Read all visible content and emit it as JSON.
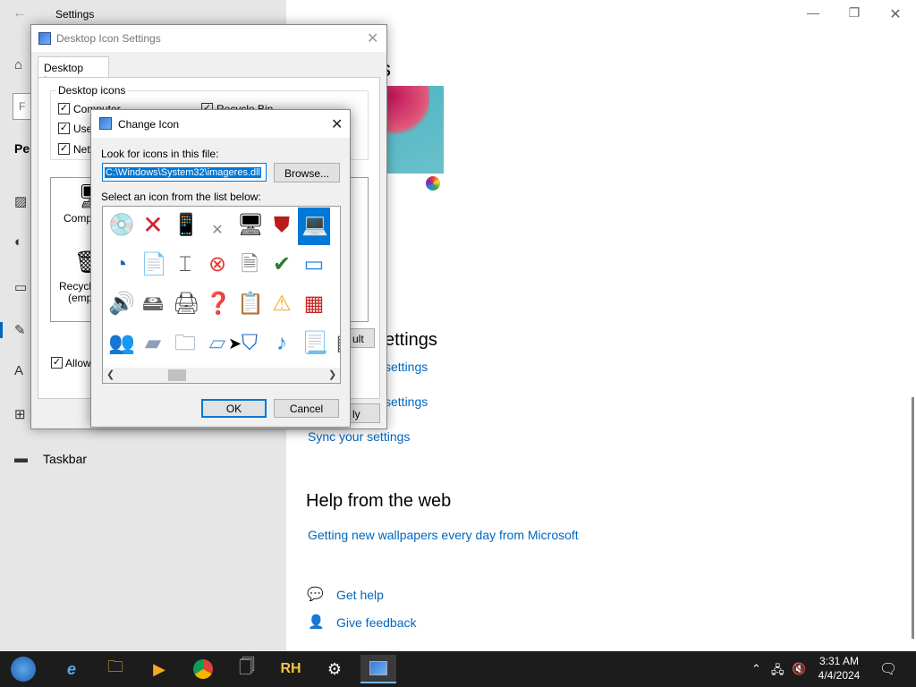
{
  "settings": {
    "title": "Settings",
    "nav_partial": "Per",
    "nav_taskbar": "Taskbar",
    "header_partial": "s",
    "section_partial_heading": "ettings",
    "link_partial_1": "settings",
    "link_partial_2": "settings",
    "sync_link": "Sync your settings",
    "help_heading": "Help from the web",
    "wallpaper_link": "Getting new wallpapers every day from Microsoft",
    "get_help": "Get help",
    "give_feedback": "Give feedback"
  },
  "desktop_icon_dialog": {
    "title": "Desktop Icon Settings",
    "tab": "Desktop Icons",
    "group_label": "Desktop icons",
    "checkboxes": [
      {
        "label": "Computer",
        "checked": true
      },
      {
        "label": "User",
        "checked": true
      },
      {
        "label": "Netw",
        "checked": true
      },
      {
        "label": "Recycle Bin",
        "checked": true
      }
    ],
    "preview_computer": "Compu",
    "preview_recycle_1": "Recycle",
    "preview_recycle_2": "(empt",
    "allow_label": "Allow t",
    "default_btn_partial": "ult",
    "apply_btn_partial": "ly"
  },
  "change_icon_dialog": {
    "title": "Change Icon",
    "look_label": "Look for icons in this file:",
    "path_value": "C:\\Windows\\System32\\imageres.dll",
    "browse_label": "Browse...",
    "select_label": "Select an icon from the list below:",
    "ok_label": "OK",
    "cancel_label": "Cancel"
  },
  "taskbar": {
    "time": "3:31 AM",
    "date": "4/4/2024",
    "pinned": [
      "start-icon",
      "ie-icon",
      "explorer-icon",
      "media-player-icon",
      "chrome-icon",
      "file-icon",
      "rh-icon",
      "settings-icon",
      "desktop-icon-settings-icon"
    ],
    "rh_label": "RH"
  },
  "colors": {
    "accent": "#0078d7",
    "link": "#0067c0",
    "taskbar": "#1c1c1c"
  }
}
